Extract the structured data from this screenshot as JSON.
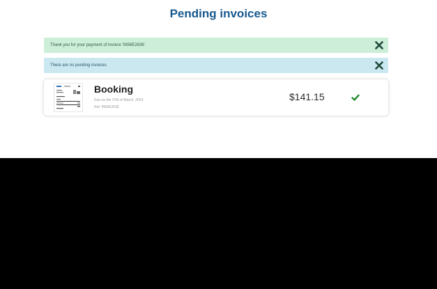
{
  "page": {
    "title": "Pending invoices"
  },
  "alerts": [
    {
      "message": "Thank you for your payment of invoice 'IN56E2636'.",
      "close_icon": "close-icon",
      "color": "#cdeed9"
    },
    {
      "message": "There are no pending invoices",
      "close_icon": "close-icon",
      "color": "#cbe8f1"
    }
  ],
  "invoice": {
    "title": "Booking",
    "due": "Due on the 27th of March, 2024",
    "ref": "Ref: IN56E2636",
    "amount": "$141.15",
    "status_icon": "checkmark-icon",
    "status_color": "#1e8a2e"
  },
  "colors": {
    "title": "#17598f",
    "close_icon": "#1f4a3a"
  }
}
